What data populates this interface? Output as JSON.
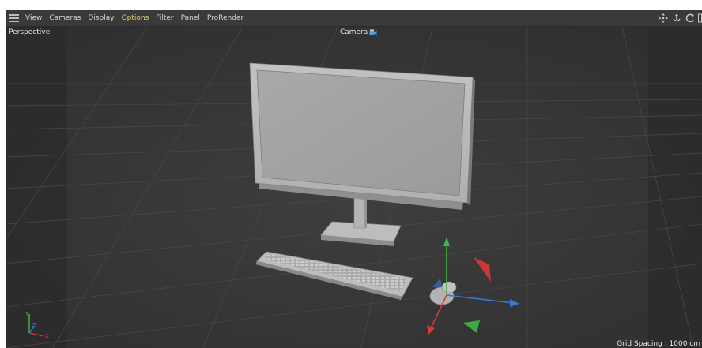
{
  "menu": {
    "hamburger_icon": "hamburger-menu-icon",
    "items": [
      {
        "label": "View",
        "active": false
      },
      {
        "label": "Cameras",
        "active": false
      },
      {
        "label": "Display",
        "active": false
      },
      {
        "label": "Options",
        "active": true
      },
      {
        "label": "Filter",
        "active": false
      },
      {
        "label": "Panel",
        "active": false
      },
      {
        "label": "ProRender",
        "active": false
      }
    ],
    "nav_icons": [
      "move-view-icon",
      "zoom-view-icon",
      "rotate-view-icon"
    ]
  },
  "viewport": {
    "projection_label": "Perspective",
    "camera_label": "Camera",
    "camera_icon": "camera-icon",
    "grid_spacing_label": "Grid Spacing : 1000 cm",
    "axis_labels": {
      "x": "X",
      "y": "Y",
      "z": "Z"
    }
  },
  "scene": {
    "objects": [
      "monitor",
      "keyboard",
      "mouse"
    ],
    "gizmo": "move-gizmo"
  },
  "colors": {
    "menu_active": "#e6d26a",
    "viewport_bg": "#333333",
    "axis_x": "#d8383a",
    "axis_y": "#3fb84a",
    "axis_z": "#3a78d6"
  }
}
